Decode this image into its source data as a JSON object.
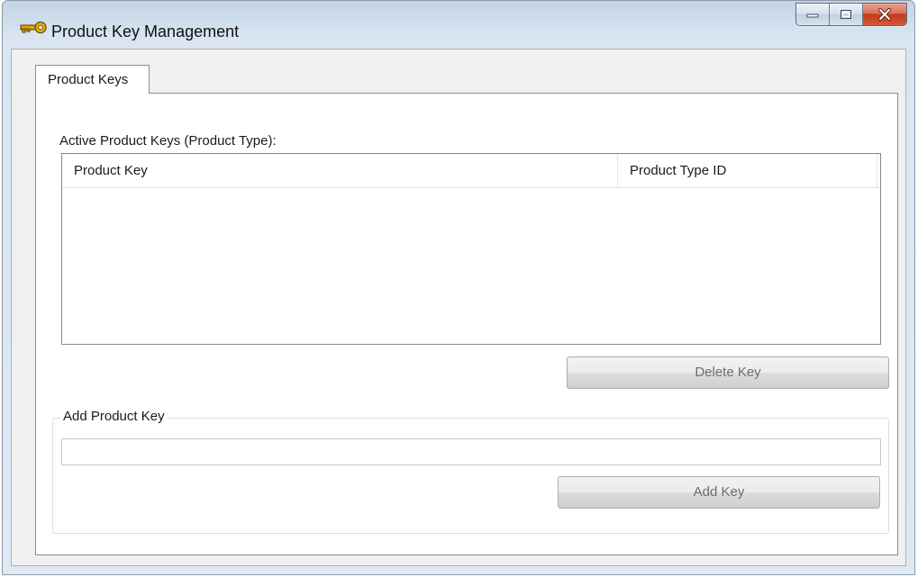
{
  "window": {
    "title": "Product Key Management",
    "icons": {
      "app": "key-icon",
      "minimize": "minimize-icon",
      "maximize": "maximize-icon",
      "close": "close-icon"
    }
  },
  "tabs": [
    {
      "label": "Product Keys"
    }
  ],
  "keys_panel": {
    "list_label": "Active Product Keys (Product Type):",
    "columns": [
      "Product Key",
      "Product Type ID"
    ],
    "rows": [],
    "delete_button": "Delete Key"
  },
  "add_group": {
    "legend": "Add Product Key",
    "input_value": "",
    "add_button": "Add Key"
  },
  "colors": {
    "close_button": "#c5391c",
    "titlebar": "#c3d4e6"
  }
}
